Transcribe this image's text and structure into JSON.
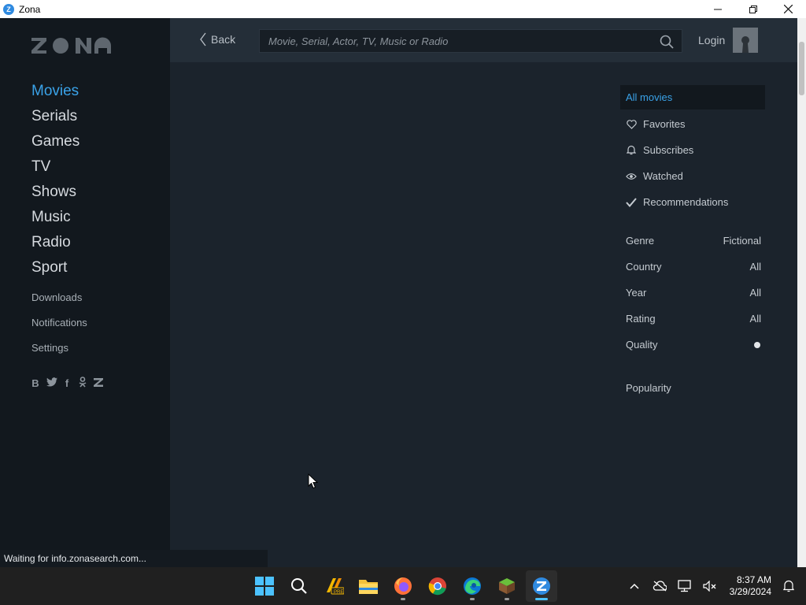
{
  "window": {
    "title": "Zona"
  },
  "sidebar": {
    "logo": "zona",
    "main_items": [
      "Movies",
      "Serials",
      "Games",
      "TV",
      "Shows",
      "Music",
      "Radio",
      "Sport"
    ],
    "secondary_items": [
      "Downloads",
      "Notifications",
      "Settings"
    ],
    "socials": [
      "vk-icon",
      "twitter-icon",
      "facebook-icon",
      "odnoklassniki-icon",
      "zona-icon"
    ]
  },
  "header": {
    "back_label": "Back",
    "search_placeholder": "Movie, Serial, Actor, TV, Music or Radio",
    "login_label": "Login"
  },
  "filters": {
    "items": [
      {
        "label": "All movies",
        "icon": "none"
      },
      {
        "label": "Favorites",
        "icon": "heart-icon"
      },
      {
        "label": "Subscribes",
        "icon": "bell-icon"
      },
      {
        "label": "Watched",
        "icon": "eye-icon"
      },
      {
        "label": "Recommendations",
        "icon": "check-icon"
      }
    ],
    "properties": [
      {
        "name": "Genre",
        "value": "Fictional"
      },
      {
        "name": "Country",
        "value": "All"
      },
      {
        "name": "Year",
        "value": "All"
      },
      {
        "name": "Rating",
        "value": "All"
      },
      {
        "name": "Quality",
        "value": ""
      }
    ],
    "sort_label": "Popularity"
  },
  "status": {
    "text": "Waiting for info.zonasearch.com..."
  },
  "taskbar": {
    "apps": [
      "start-icon",
      "search-icon",
      "app-pre-icon",
      "file-explorer-icon",
      "firefox-icon",
      "chrome-icon",
      "edge-icon",
      "minecraft-icon",
      "zona-icon"
    ],
    "time": "8:37 AM",
    "date": "3/29/2024"
  },
  "colors": {
    "accent": "#3aa2e8",
    "sidebar_bg": "#12181e",
    "content_bg": "#1b232c",
    "topbar_bg": "#242e38"
  }
}
